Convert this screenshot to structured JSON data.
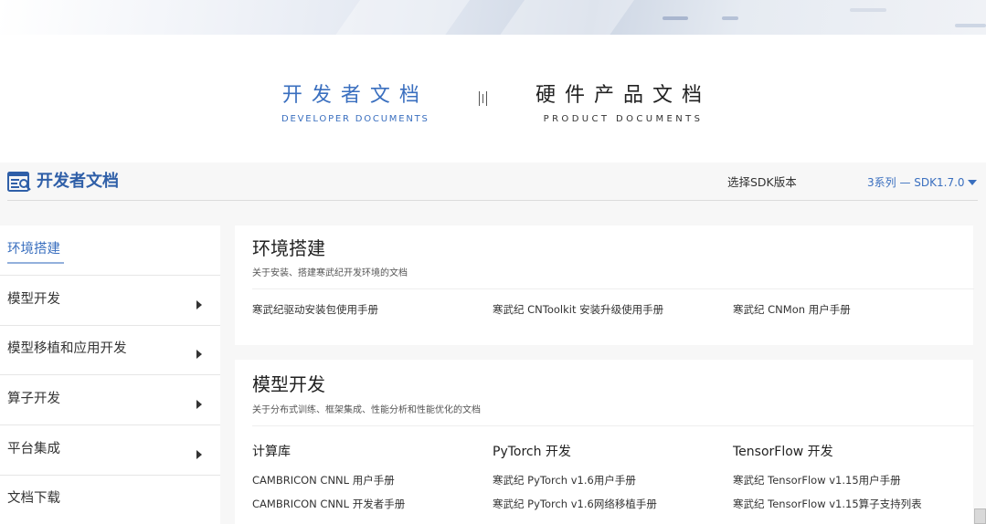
{
  "doc_switch": {
    "developer": {
      "title": "开发者文档",
      "subtitle": "DEVELOPER DOCUMENTS"
    },
    "product": {
      "title": "硬件产品文档",
      "subtitle": "PRODUCT DOCUMENTS"
    },
    "accent_color": "#3a6fbf"
  },
  "header": {
    "title": "开发者文档",
    "sdk_label": "选择SDK版本",
    "sdk_selected": "3系列 — SDK1.7.0"
  },
  "sidebar": {
    "items": [
      {
        "label": "环境搭建",
        "active": true
      },
      {
        "label": "模型开发",
        "has_submenu": true
      },
      {
        "label": "模型移植和应用开发",
        "has_submenu": true
      },
      {
        "label": "算子开发",
        "has_submenu": true
      },
      {
        "label": "平台集成",
        "has_submenu": true
      },
      {
        "label": "文档下载"
      }
    ]
  },
  "sections": {
    "env": {
      "title": "环境搭建",
      "desc": "关于安装、搭建寒武纪开发环境的文档",
      "links": [
        "寒武纪驱动安装包使用手册",
        "寒武纪 CNToolkit 安装升级使用手册",
        "寒武纪 CNMon 用户手册"
      ]
    },
    "model": {
      "title": "模型开发",
      "desc": "关于分布式训练、框架集成、性能分析和性能优化的文档",
      "columns": [
        {
          "heading": "计算库",
          "links": [
            "CAMBRICON CNNL 用户手册",
            "CAMBRICON CNNL 开发者手册"
          ]
        },
        {
          "heading": "PyTorch 开发",
          "links": [
            "寒武纪 PyTorch v1.6用户手册",
            "寒武纪 PyTorch v1.6网络移植手册"
          ]
        },
        {
          "heading": "TensorFlow 开发",
          "links": [
            "寒武纪 TensorFlow v1.15用户手册",
            "寒武纪 TensorFlow v1.15算子支持列表"
          ]
        }
      ]
    }
  }
}
